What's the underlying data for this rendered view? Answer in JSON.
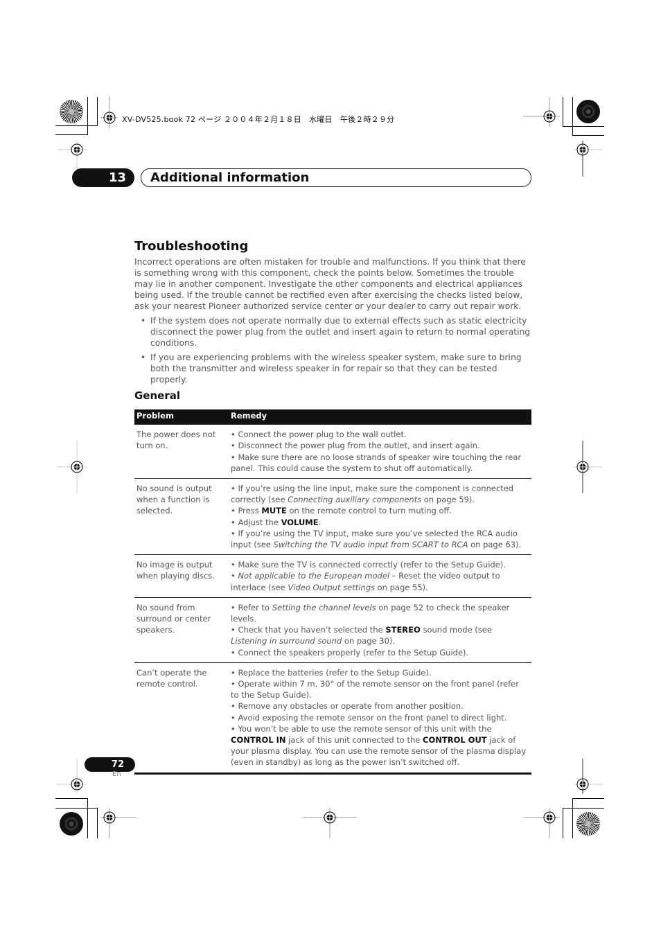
{
  "slug": "XV-DV525.book  72 ページ  ２００４年２月１８日　水曜日　午後２時２９分",
  "chapter": {
    "number": "13",
    "title": "Additional information"
  },
  "page_title": "Troubleshooting",
  "intro": "Incorrect operations are often mistaken for trouble and malfunctions. If you think that there is something wrong with this component, check the points below. Sometimes the trouble may lie in another component. Investigate the other components and electrical appliances being used. If the trouble cannot be rectified even after exercising the checks listed below, ask your nearest Pioneer authorized service center or your dealer to carry out repair work.",
  "bullets": [
    "If the system does not operate normally due to external effects such as static electricity disconnect the power plug from the outlet and insert again to return to normal operating conditions.",
    "If you are experiencing problems with the wireless speaker system, make sure to bring both the transmitter and wireless speaker in for repair so that they can be tested properly."
  ],
  "section_title": "General",
  "table": {
    "headers": {
      "problem": "Problem",
      "remedy": "Remedy"
    },
    "rows": [
      {
        "problem": "The power does not turn on.",
        "remedy": [
          [
            {
              "t": "• Connect the power plug to the wall outlet."
            }
          ],
          [
            {
              "t": "• Disconnect the power plug from the outlet, and insert again."
            }
          ],
          [
            {
              "t": "• Make sure there are no loose strands of speaker wire touching the rear panel. This could cause the system to shut off automatically."
            }
          ]
        ]
      },
      {
        "problem": "No sound is output when a function is selected.",
        "remedy": [
          [
            {
              "t": "• If you’re using the line input, make sure the component is connected correctly (see "
            },
            {
              "t": "Connecting auxiliary components",
              "s": "i"
            },
            {
              "t": " on page 59)."
            }
          ],
          [
            {
              "t": "• Press "
            },
            {
              "t": "MUTE",
              "s": "b"
            },
            {
              "t": " on the remote control to turn muting off."
            }
          ],
          [
            {
              "t": "• Adjust the "
            },
            {
              "t": "VOLUME",
              "s": "b"
            },
            {
              "t": "."
            }
          ],
          [
            {
              "t": "• If you’re using the TV input, make sure you’ve selected the RCA audio input (see "
            },
            {
              "t": "Switching the TV audio input from SCART to RCA",
              "s": "i"
            },
            {
              "t": " on page 63)."
            }
          ]
        ]
      },
      {
        "problem": "No image is output when playing discs.",
        "remedy": [
          [
            {
              "t": "• Make sure the TV is connected correctly (refer to the Setup Guide)."
            }
          ],
          [
            {
              "t": "• "
            },
            {
              "t": "Not applicable to the European model",
              "s": "i"
            },
            {
              "t": " – Reset the video output to interlace (see "
            },
            {
              "t": "Video Output settings",
              "s": "i"
            },
            {
              "t": " on page 55)."
            }
          ]
        ]
      },
      {
        "problem": "No sound from surround or center speakers.",
        "remedy": [
          [
            {
              "t": "• Refer to "
            },
            {
              "t": "Setting the channel levels",
              "s": "i"
            },
            {
              "t": " on page 52 to check the speaker levels."
            }
          ],
          [
            {
              "t": "• Check that you haven’t selected the "
            },
            {
              "t": "STEREO",
              "s": "b"
            },
            {
              "t": " sound mode (see "
            },
            {
              "t": "Listening in surround sound",
              "s": "i"
            },
            {
              "t": " on page 30)."
            }
          ],
          [
            {
              "t": "• Connect the speakers properly (refer to the Setup Guide)."
            }
          ]
        ]
      },
      {
        "problem": "Can’t operate the remote control.",
        "remedy": [
          [
            {
              "t": "• Replace the batteries (refer to the Setup Guide)."
            }
          ],
          [
            {
              "t": "• Operate within 7 m, 30° of the remote sensor on the front panel (refer to the Setup Guide)."
            }
          ],
          [
            {
              "t": "• Remove any obstacles or operate from another position."
            }
          ],
          [
            {
              "t": "• Avoid exposing the remote sensor on the front panel to direct light."
            }
          ],
          [
            {
              "t": "• You won’t be able to use the remote sensor of this unit with the "
            },
            {
              "t": "CONTROL IN",
              "s": "b"
            },
            {
              "t": " jack of this unit connected to the "
            },
            {
              "t": "CONTROL OUT",
              "s": "b"
            },
            {
              "t": " jack of your plasma display. You can use the remote sensor of the plasma display (even in standby) as long as the power isn’t switched off."
            }
          ]
        ]
      }
    ]
  },
  "footer": {
    "page_number": "72",
    "language": "En"
  }
}
